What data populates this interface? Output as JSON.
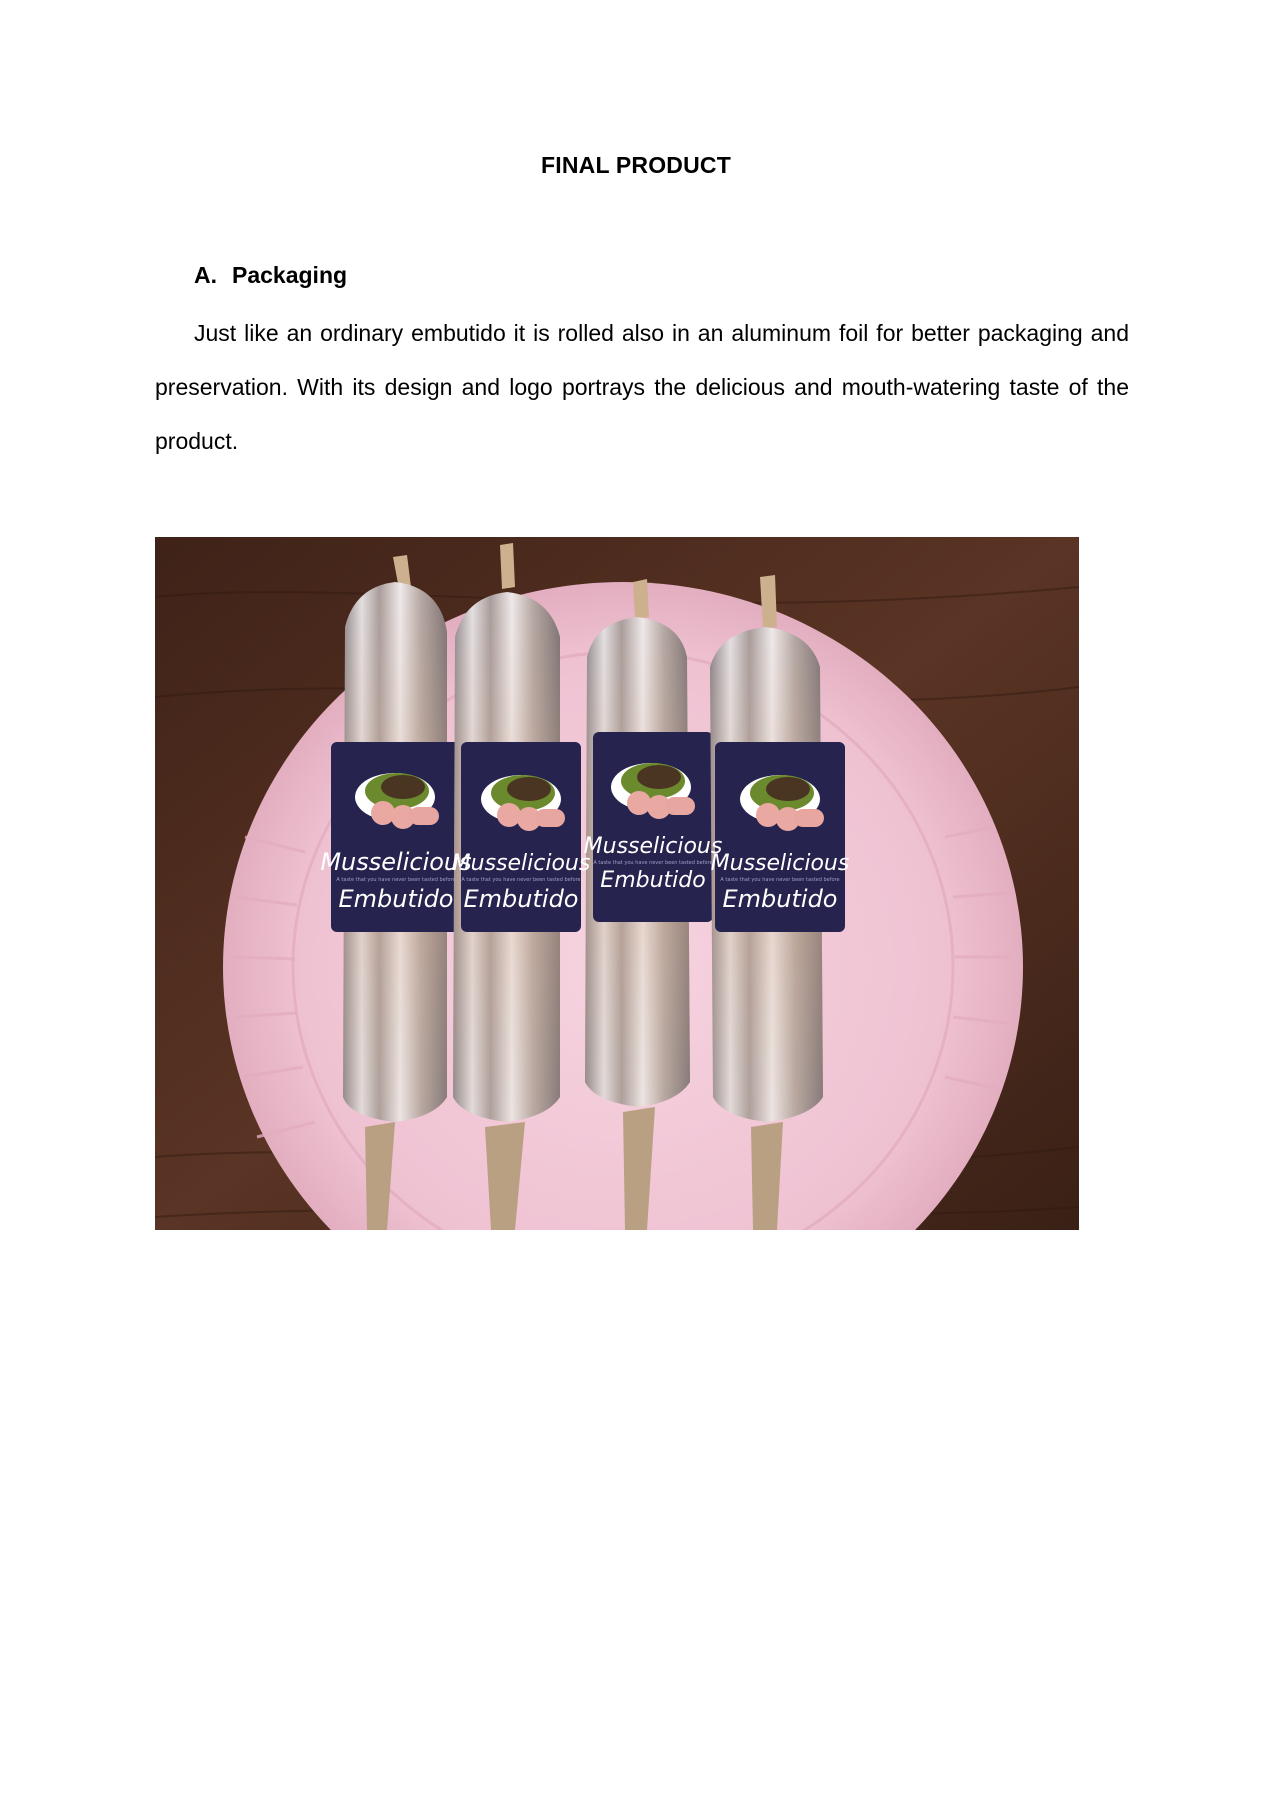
{
  "document": {
    "title": "FINAL PRODUCT",
    "section": {
      "letter": "A.",
      "heading": "Packaging"
    },
    "paragraph": "Just like an ordinary embutido it is rolled also in an aluminum foil for better packaging and preservation. With its design and logo portrays the delicious and mouth-watering taste of the product."
  },
  "photo": {
    "label_brand": "Musselicious",
    "label_product": "Embutido",
    "label_tagline": "A taste that you have never been tasted before",
    "colors": {
      "table_wood": "#4a2a1c",
      "plate": "#f0c8d6",
      "label_bg": "#26234f",
      "foil": "#c9c3c6"
    }
  }
}
